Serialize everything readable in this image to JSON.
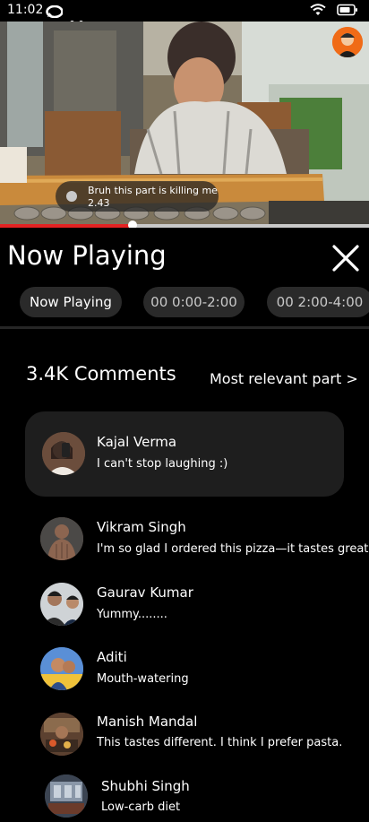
{
  "status_bar": {
    "time": "11:02",
    "icons": [
      "message-icon",
      "wifi-icon",
      "battery-icon"
    ]
  },
  "video": {
    "overlay_comment": {
      "text": "Bruh this part is killing me",
      "timestamp": "2.43"
    },
    "progress_fraction": 0.36,
    "progress_color": "#e32222"
  },
  "panel": {
    "title": "Now Playing",
    "close_icon": "close-icon",
    "chips": [
      {
        "label": "Now Playing",
        "active": true
      },
      {
        "label": "00 0:00-2:00",
        "active": false
      },
      {
        "label": "00 2:00-4:00",
        "active": false
      }
    ]
  },
  "comments_header": {
    "count": "3.4K Comments",
    "sort_label": "Most relevant part  >"
  },
  "comments": [
    {
      "name": "Kajal Verma",
      "text": "I can't stop laughing :)",
      "highlighted": true,
      "avatar_color": "#6b4d3c"
    },
    {
      "name": "Vikram Singh",
      "text": "I'm so glad I ordered this pizza—it tastes great!",
      "highlighted": false,
      "avatar_color": "#7b5a49"
    },
    {
      "name": "Gaurav Kumar",
      "text": "Yummy........",
      "highlighted": false,
      "avatar_color": "#5b5f63"
    },
    {
      "name": "Aditi",
      "text": "Mouth-watering",
      "highlighted": false,
      "avatar_color": "#3b6db3"
    },
    {
      "name": "Manish Mandal",
      "text": "This tastes different. I think I prefer pasta.",
      "highlighted": false,
      "avatar_color": "#6a4b34"
    },
    {
      "name": "Shubhi Singh",
      "text": "Low-carb diet",
      "highlighted": false,
      "avatar_color": "#4c5563"
    }
  ]
}
